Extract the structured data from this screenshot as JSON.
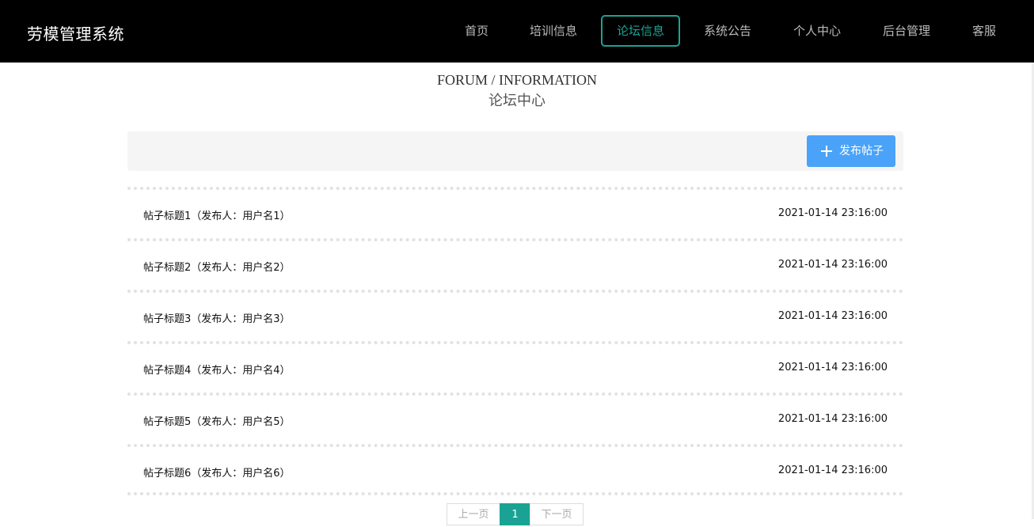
{
  "header": {
    "brand": "劳模管理系统",
    "nav": [
      {
        "label": "首页",
        "active": false
      },
      {
        "label": "培训信息",
        "active": false
      },
      {
        "label": "论坛信息",
        "active": true
      },
      {
        "label": "系统公告",
        "active": false
      },
      {
        "label": "个人中心",
        "active": false
      },
      {
        "label": "后台管理",
        "active": false
      },
      {
        "label": "客服",
        "active": false
      }
    ]
  },
  "page": {
    "title_en": "FORUM / INFORMATION",
    "title_cn": "论坛中心"
  },
  "toolbar": {
    "publish_label": "发布帖子",
    "publish_icon": "plus-icon"
  },
  "posts": [
    {
      "title": "帖子标题1（发布人：用户名1）",
      "time": "2021-01-14 23:16:00"
    },
    {
      "title": "帖子标题2（发布人：用户名2）",
      "time": "2021-01-14 23:16:00"
    },
    {
      "title": "帖子标题3（发布人：用户名3）",
      "time": "2021-01-14 23:16:00"
    },
    {
      "title": "帖子标题4（发布人：用户名4）",
      "time": "2021-01-14 23:16:00"
    },
    {
      "title": "帖子标题5（发布人：用户名5）",
      "time": "2021-01-14 23:16:00"
    },
    {
      "title": "帖子标题6（发布人：用户名6）",
      "time": "2021-01-14 23:16:00"
    }
  ],
  "pagination": {
    "prev": "上一页",
    "current": "1",
    "next": "下一页"
  },
  "colors": {
    "header_bg": "#000000",
    "accent": "#1aa394",
    "button_blue": "#4aa3f8"
  }
}
